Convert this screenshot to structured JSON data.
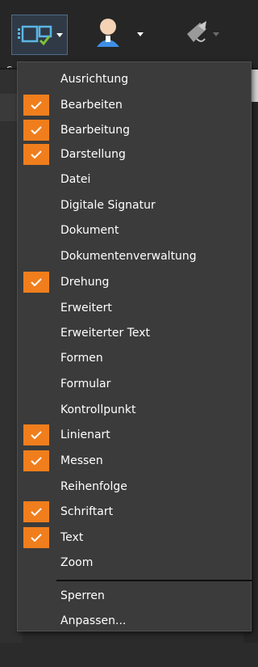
{
  "toolbar": {
    "label_fragment": "Sy",
    "buttons": [
      {
        "name": "toolbars-toggle",
        "icon": "toolbar-check-icon",
        "active": true
      },
      {
        "name": "user",
        "icon": "user-icon"
      },
      {
        "name": "sign",
        "icon": "pen-document-icon",
        "disabled": true
      }
    ]
  },
  "menu": {
    "items": [
      {
        "label": "Ausrichtung",
        "checked": false
      },
      {
        "label": "Bearbeiten",
        "checked": true
      },
      {
        "label": "Bearbeitung",
        "checked": true
      },
      {
        "label": "Darstellung",
        "checked": true
      },
      {
        "label": "Datei",
        "checked": false
      },
      {
        "label": "Digitale Signatur",
        "checked": false
      },
      {
        "label": "Dokument",
        "checked": false
      },
      {
        "label": "Dokumentenverwaltung",
        "checked": false
      },
      {
        "label": "Drehung",
        "checked": true
      },
      {
        "label": "Erweitert",
        "checked": false
      },
      {
        "label": "Erweiterter Text",
        "checked": false
      },
      {
        "label": "Formen",
        "checked": false
      },
      {
        "label": "Formular",
        "checked": false
      },
      {
        "label": "Kontrollpunkt",
        "checked": false
      },
      {
        "label": "Linienart",
        "checked": true
      },
      {
        "label": "Messen",
        "checked": true
      },
      {
        "label": "Reihenfolge",
        "checked": false
      },
      {
        "label": "Schriftart",
        "checked": true
      },
      {
        "label": "Text",
        "checked": true
      },
      {
        "label": "Zoom",
        "checked": false
      }
    ],
    "footer_items": [
      {
        "label": "Sperren"
      },
      {
        "label": "Anpassen..."
      }
    ]
  },
  "colors": {
    "check_accent": "#f07e1d",
    "menu_background": "#3b3b3b",
    "active_button_border": "#4e6c8a"
  }
}
